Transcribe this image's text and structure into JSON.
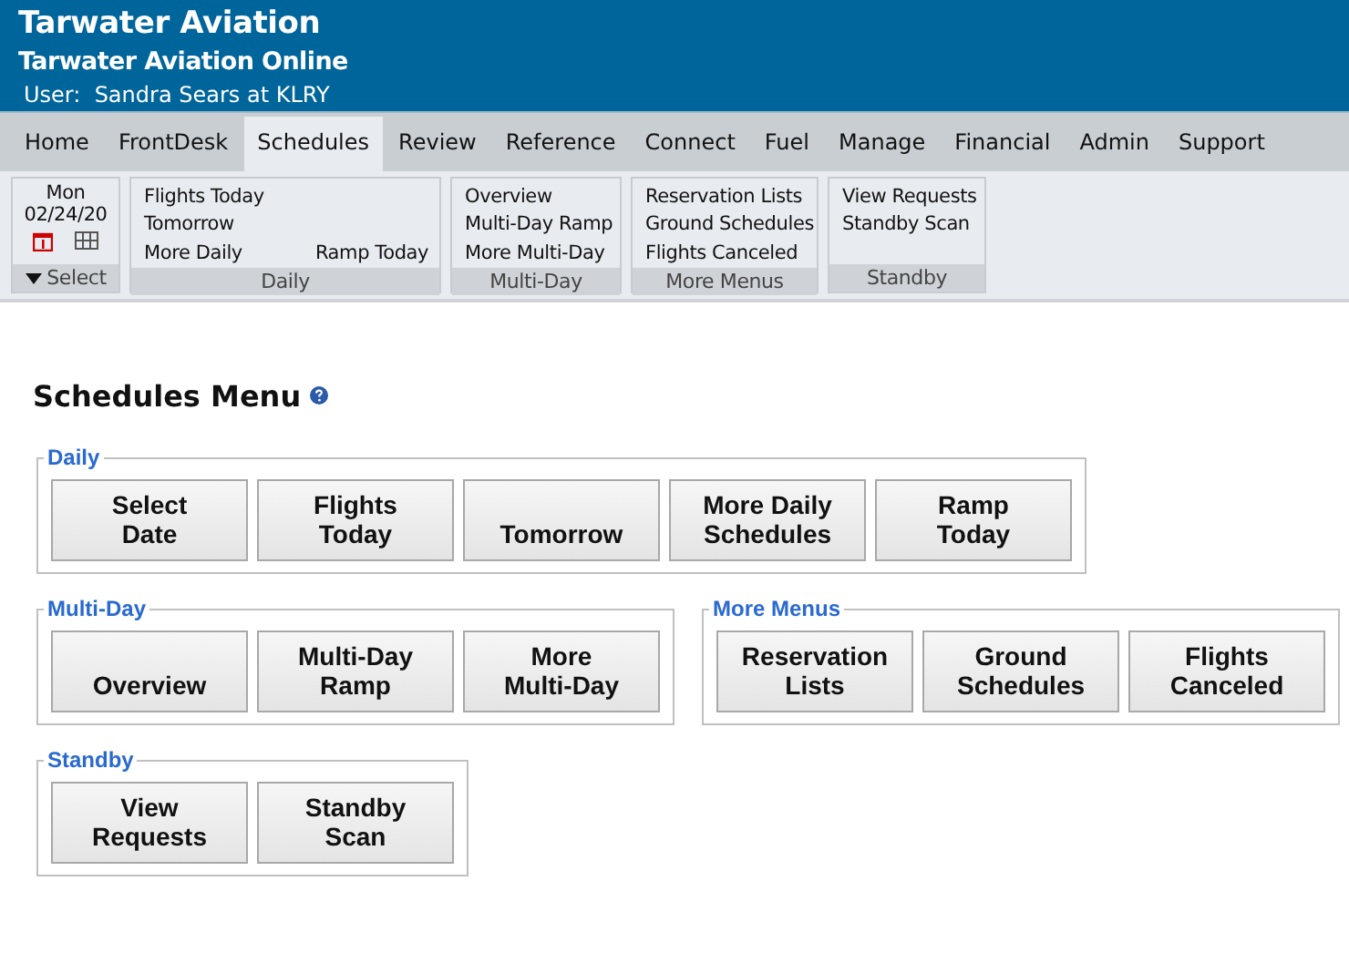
{
  "header": {
    "title": "Tarwater Aviation",
    "subtitle": "Tarwater Aviation Online",
    "user": "User:  Sandra Sears at KLRY"
  },
  "tabs": [
    {
      "label": "Home",
      "selected": false
    },
    {
      "label": "FrontDesk",
      "selected": false
    },
    {
      "label": "Schedules",
      "selected": true
    },
    {
      "label": "Review",
      "selected": false
    },
    {
      "label": "Reference",
      "selected": false
    },
    {
      "label": "Connect",
      "selected": false
    },
    {
      "label": "Fuel",
      "selected": false
    },
    {
      "label": "Manage",
      "selected": false
    },
    {
      "label": "Financial",
      "selected": false
    },
    {
      "label": "Admin",
      "selected": false
    },
    {
      "label": "Support",
      "selected": false
    }
  ],
  "ribbon": [
    {
      "kind": "date",
      "day": "Mon",
      "date": "02/24/20",
      "label": "Select"
    },
    {
      "kind": "links",
      "rows": [
        [
          "Flights Today"
        ],
        [
          "Tomorrow"
        ],
        [
          "More Daily",
          "Ramp Today"
        ]
      ],
      "label": "Daily"
    },
    {
      "kind": "links",
      "rows": [
        [
          "Overview"
        ],
        [
          "Multi-Day Ramp"
        ],
        [
          "More Multi-Day"
        ]
      ],
      "label": "Multi-Day"
    },
    {
      "kind": "links",
      "rows": [
        [
          "Reservation Lists"
        ],
        [
          "Ground Schedules"
        ],
        [
          "Flights Canceled"
        ]
      ],
      "label": "More Menus"
    },
    {
      "kind": "links",
      "rows": [
        [
          "View Requests"
        ],
        [
          "Standby Scan"
        ]
      ],
      "label": "Standby"
    }
  ],
  "page_title": "Schedules Menu",
  "sections": [
    {
      "legend": "Daily",
      "buttons": [
        [
          "Select",
          "Date"
        ],
        [
          "Flights",
          "Today"
        ],
        [
          "Tomorrow"
        ],
        [
          "More Daily",
          "Schedules"
        ],
        [
          "Ramp",
          "Today"
        ]
      ]
    },
    {
      "legend": "Multi-Day",
      "buttons": [
        [
          "Overview"
        ],
        [
          "Multi-Day",
          "Ramp"
        ],
        [
          "More",
          "Multi-Day"
        ]
      ]
    },
    {
      "legend": "More Menus",
      "buttons": [
        [
          "Reservation",
          "Lists"
        ],
        [
          "Ground",
          "Schedules"
        ],
        [
          "Flights",
          "Canceled"
        ]
      ]
    },
    {
      "legend": "Standby",
      "buttons": [
        [
          "View",
          "Requests"
        ],
        [
          "Standby",
          "Scan"
        ]
      ]
    }
  ]
}
